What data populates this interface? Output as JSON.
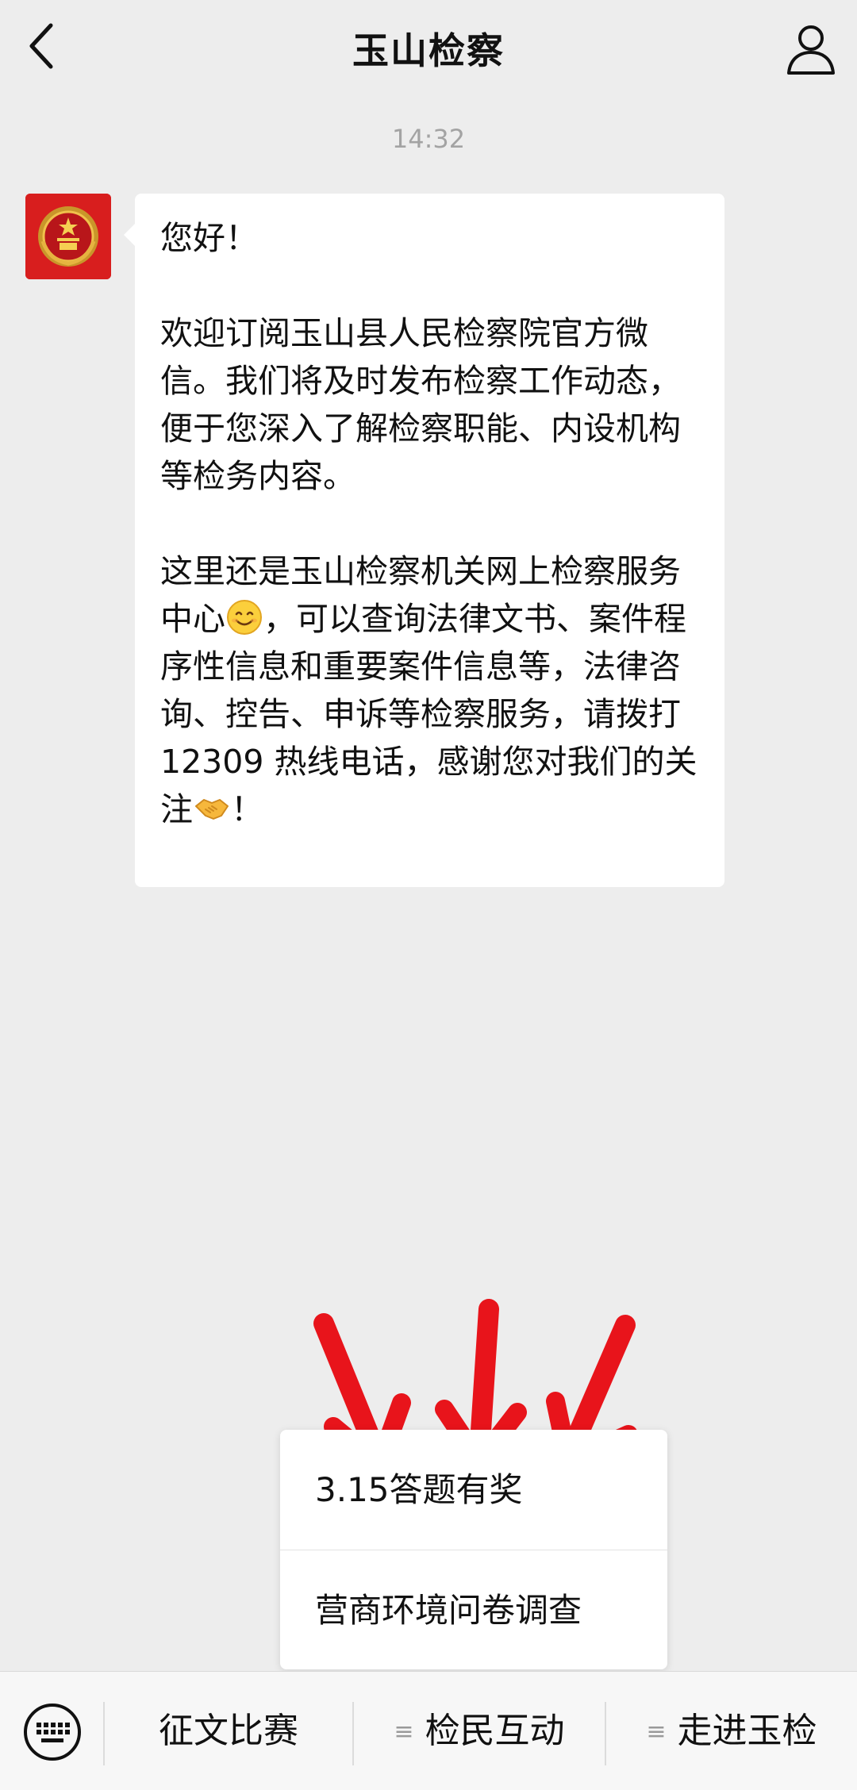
{
  "header": {
    "title": "玉山检察"
  },
  "chat": {
    "timestamp": "14:32",
    "message": {
      "greeting": "您好！",
      "para1": "欢迎订阅玉山县人民检察院官方微信。我们将及时发布检察工作动态，便于您深入了解检察职能、内设机构等检务内容。",
      "para2_a": "这里还是玉山检察机关网上检察服务中心",
      "para2_b": "，可以查询法律文书、案件程序性信息和重要案件信息等，法律咨询、控告、申诉等检察服务，请拨打 12309 热线电话，感谢您对我们的关注",
      "para2_c": "！"
    }
  },
  "popup_menu": {
    "items": [
      {
        "label": "3.15答题有奖"
      },
      {
        "label": "营商环境问卷调查"
      }
    ]
  },
  "menu_bar": {
    "tabs": [
      {
        "label": "征文比赛"
      },
      {
        "label": "检民互动"
      },
      {
        "label": "走进玉检"
      }
    ],
    "menu_glyph": "≡"
  },
  "icons": {
    "back": "chevron-left-icon",
    "profile": "person-icon",
    "keyboard": "keyboard-icon",
    "smile_emoji": "smile-emoji-icon",
    "handshake_emoji": "handshake-emoji-icon"
  },
  "colors": {
    "background": "#ededed",
    "bubble": "#ffffff",
    "avatar_red": "#d81e1e",
    "annotation_red": "#e8141b",
    "timestamp_gray": "#a3a3a3"
  }
}
